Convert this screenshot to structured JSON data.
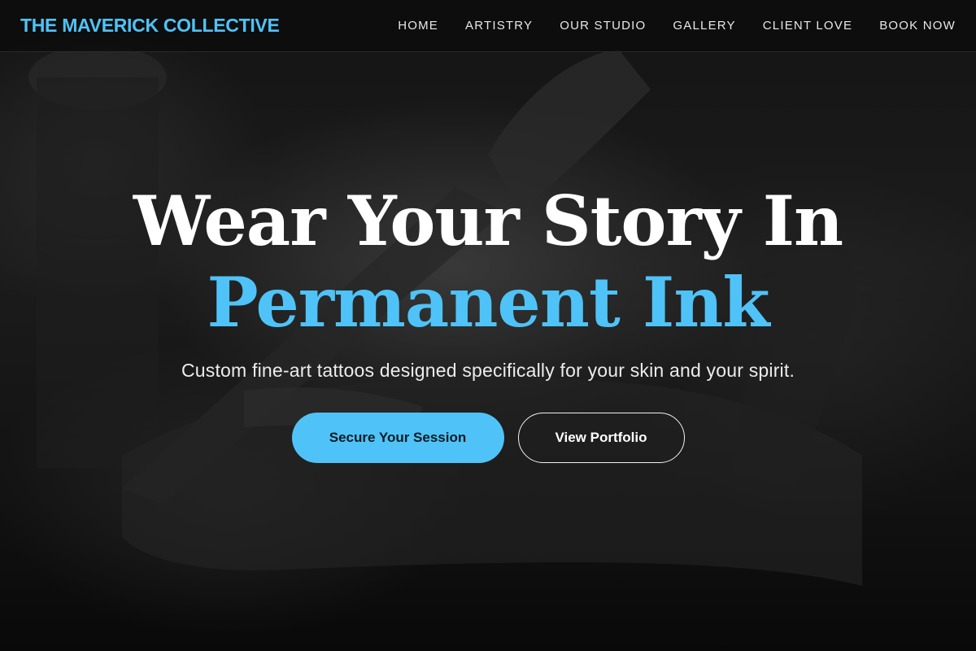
{
  "brand": {
    "name": "THE MAVERICK COLLECTIVE"
  },
  "nav": {
    "items": [
      {
        "label": "HOME"
      },
      {
        "label": "ARTISTRY"
      },
      {
        "label": "OUR STUDIO"
      },
      {
        "label": "GALLERY"
      },
      {
        "label": "CLIENT LOVE"
      },
      {
        "label": "BOOK NOW"
      }
    ]
  },
  "hero": {
    "headline_line1": "Wear Your Story In",
    "headline_line2": "Permanent Ink",
    "subheadline": "Custom fine-art tattoos designed specifically for your skin and your spirit.",
    "primary_cta": "Secure Your Session",
    "secondary_cta": "View Portfolio",
    "background_image": "tattoo-artist-at-work-photo"
  },
  "colors": {
    "accent": "#4fc3f7",
    "background": "#0b0b0b",
    "text": "#ffffff"
  }
}
